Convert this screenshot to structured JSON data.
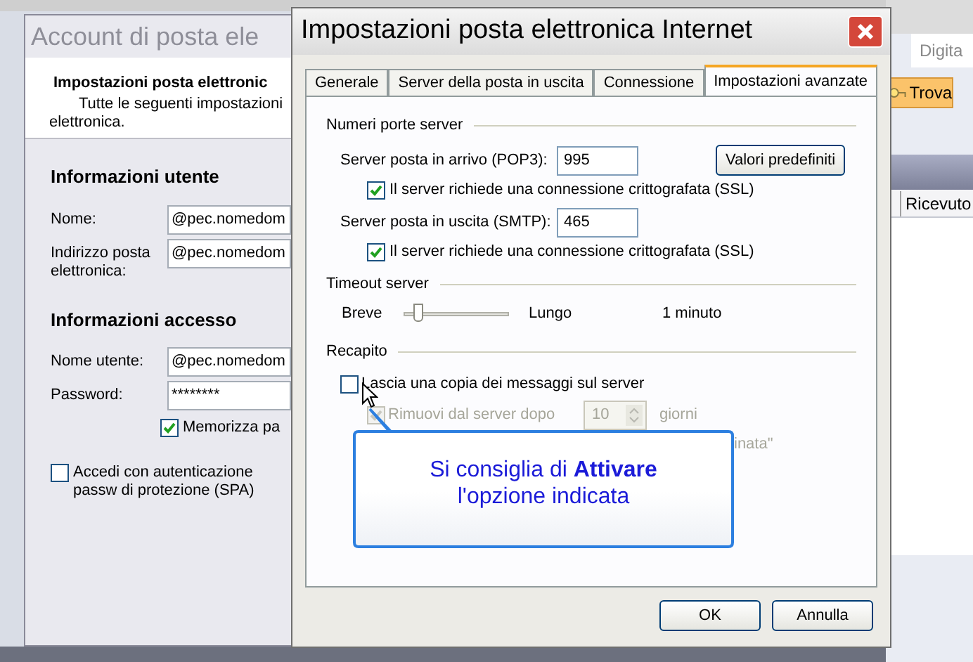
{
  "background_window": {
    "title": "Account di posta ele",
    "header": {
      "title": "Impostazioni posta elettronic",
      "description_lines": [
        "Tutte le seguenti impostazioni",
        "elettronica."
      ]
    },
    "sections": [
      {
        "heading": "Informazioni utente",
        "fields": [
          {
            "label": "Nome:",
            "value": "@pec.nomedom"
          },
          {
            "label": "Indirizzo posta elettronica:",
            "value": "@pec.nomedom"
          }
        ]
      },
      {
        "heading": "Informazioni accesso",
        "fields": [
          {
            "label": "Nome utente:",
            "value": "@pec.nomedom"
          },
          {
            "label": "Password:",
            "value": "********"
          }
        ]
      }
    ],
    "remember_password": {
      "label": "Memorizza pa",
      "checked": true
    },
    "spa": {
      "label": "Accedi con autenticazione passw di protezione (SPA)",
      "checked": false
    }
  },
  "outlook": {
    "search_hint": "Digita",
    "find_button": "Trova",
    "column": "Ricevuto"
  },
  "dialog": {
    "title": "Impostazioni posta elettronica Internet",
    "tabs": [
      {
        "label": "Generale",
        "selected": false
      },
      {
        "label": "Server della posta in uscita",
        "selected": false
      },
      {
        "label": "Connessione",
        "selected": false
      },
      {
        "label": "Impostazioni avanzate",
        "selected": true
      }
    ],
    "ports": {
      "heading": "Numeri porte server",
      "defaults_button": "Valori predefiniti",
      "servers": [
        {
          "label": "Server posta in arrivo (POP3):",
          "value": "995",
          "ssl": {
            "label": "Il server richiede una connessione crittografata (SSL)",
            "checked": true
          }
        },
        {
          "label": "Server posta in uscita (SMTP):",
          "value": "465",
          "ssl": {
            "label": "Il server richiede una connessione crittografata (SSL)",
            "checked": true
          }
        }
      ]
    },
    "timeout": {
      "heading": "Timeout server",
      "min_label": "Breve",
      "max_label": "Lungo",
      "level": 0.1,
      "reading": "1 minuto"
    },
    "delivery": {
      "heading": "Recapito",
      "leave_copy": {
        "label": "Lascia una copia dei messaggi sul server",
        "checked": false
      },
      "remove_after": {
        "label": "Rimuovi dal server dopo",
        "checked": true,
        "disabled": true,
        "value": "10",
        "unit": "giorni"
      },
      "hidden_option_tail": "inata\""
    },
    "callout": "Si consiglia di **Attivare** l'opzione indicata",
    "buttons": [
      "OK",
      "Annulla"
    ]
  }
}
